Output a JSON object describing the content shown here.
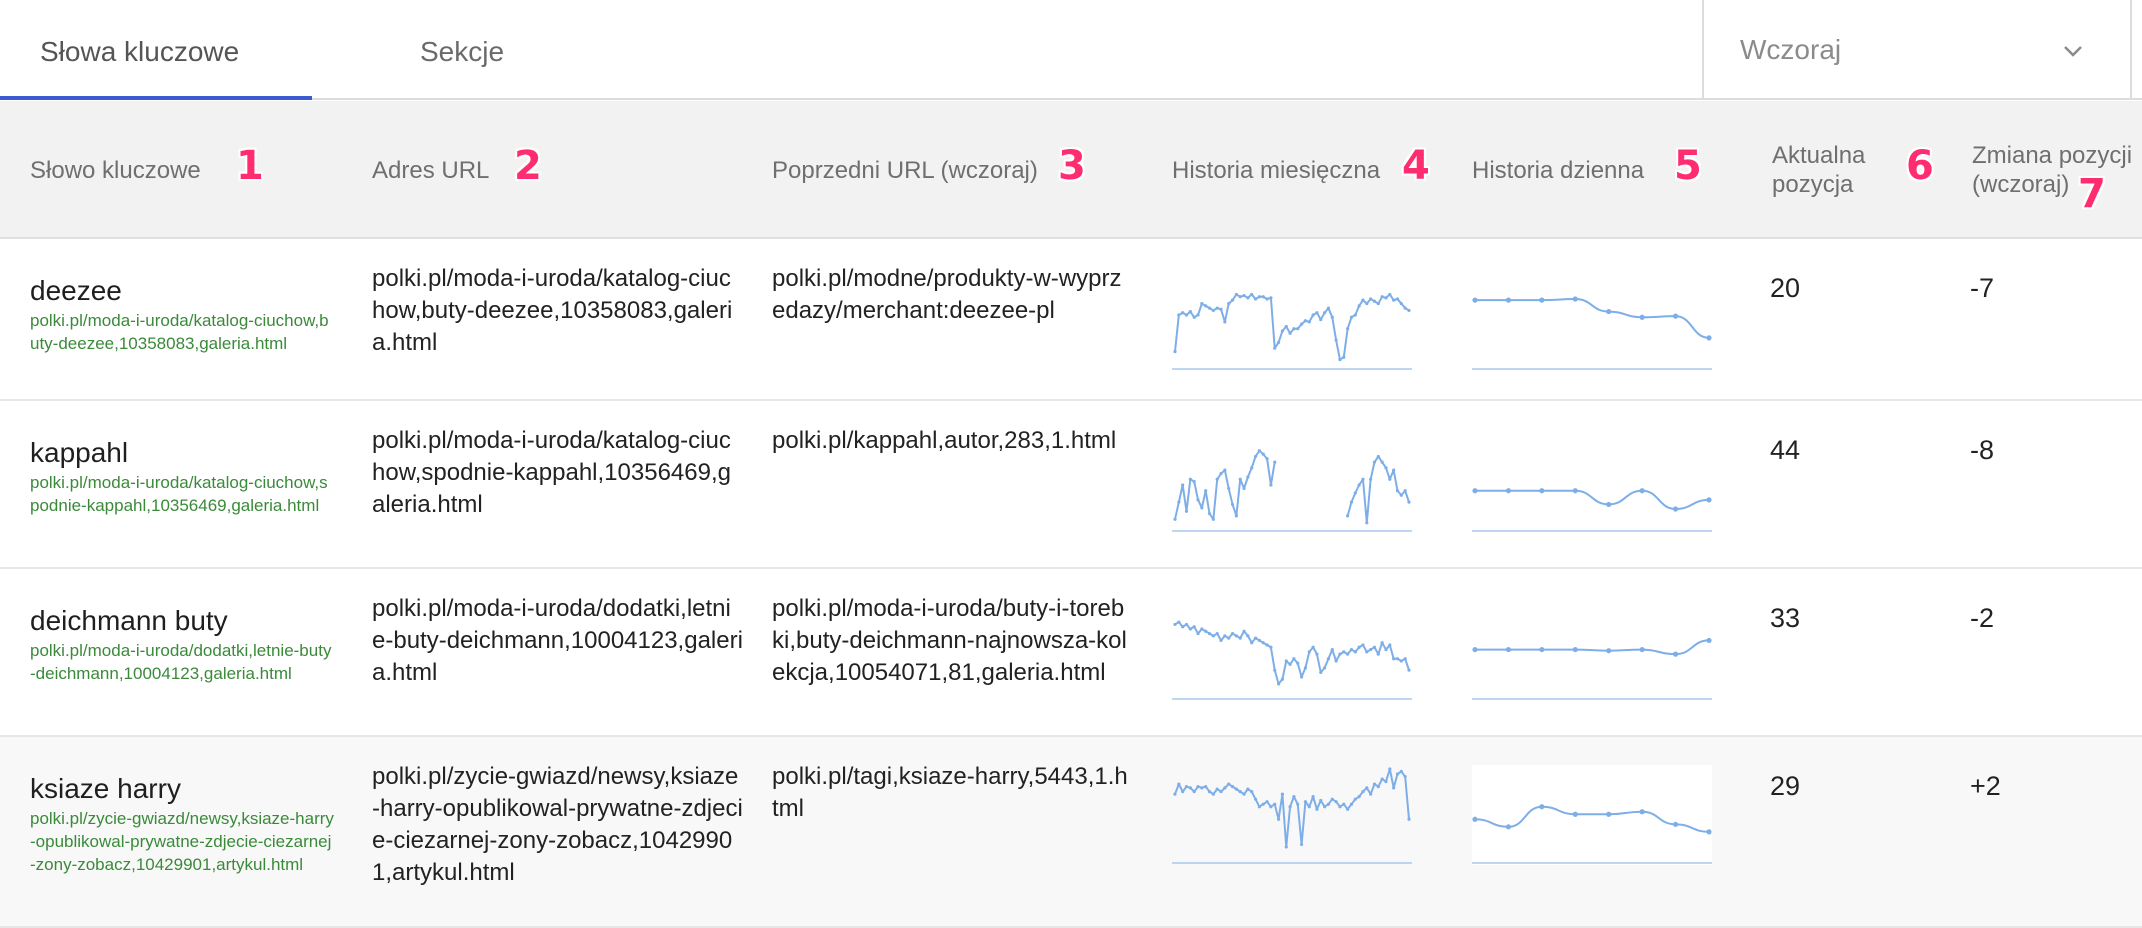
{
  "tabs": [
    {
      "label": "Słowa kluczowe",
      "active": true
    },
    {
      "label": "Sekcje",
      "active": false
    }
  ],
  "period": {
    "selected": "Wczoraj"
  },
  "columns": [
    {
      "label": "Słowo kluczowe",
      "marker": "1"
    },
    {
      "label": "Adres URL",
      "marker": "2"
    },
    {
      "label": "Poprzedni URL (wczoraj)",
      "marker": "3"
    },
    {
      "label": "Historia miesięczna",
      "marker": "4"
    },
    {
      "label": "Historia dzienna",
      "marker": "5"
    },
    {
      "label": "Aktualna pozycja",
      "marker": "6"
    },
    {
      "label": "Zmiana pozycji (wczoraj)",
      "marker": "7"
    }
  ],
  "colors": {
    "accent": "#3b5bd1",
    "marker": "#ff2d6f",
    "kw_url": "#3a8a3a",
    "spark": "#7eaee8"
  },
  "rows": [
    {
      "keyword": "deezee",
      "keyword_url": "polki.pl/moda-i-uroda/katalog-ciuchow,buty-deezee,10358083,galeria.html",
      "url": "polki.pl/moda-i-uroda/katalog-ciuchow,buty-deezee,10358083,galeria.html",
      "prev_url": "polki.pl/modne/produkty-w-wyprzedazy/merchant:deezee-pl",
      "position": "20",
      "change": "-7",
      "monthly": [
        10,
        42,
        44,
        42,
        45,
        40,
        42,
        52,
        50,
        48,
        46,
        48,
        47,
        36,
        52,
        55,
        60,
        58,
        59,
        57,
        60,
        56,
        58,
        58,
        56,
        57,
        13,
        18,
        28,
        32,
        26,
        30,
        30,
        34,
        37,
        36,
        42,
        44,
        38,
        44,
        48,
        40,
        20,
        3,
        5,
        30,
        40,
        42,
        50,
        55,
        52,
        56,
        54,
        52,
        58,
        57,
        60,
        55,
        56,
        52,
        48,
        46
      ],
      "daily": [
        55,
        55,
        55,
        56,
        45,
        40,
        41,
        22
      ],
      "daily_bg": false
    },
    {
      "keyword": "kappahl",
      "keyword_url": "polki.pl/moda-i-uroda/katalog-ciuchow,spodnie-kappahl,10356469,galeria.html",
      "url": "polki.pl/moda-i-uroda/katalog-ciuchow,spodnie-kappahl,10356469,galeria.html",
      "prev_url": "polki.pl/kappahl,autor,283,1.html",
      "position": "44",
      "change": "-8",
      "monthly": [
        5,
        20,
        35,
        12,
        40,
        38,
        22,
        15,
        30,
        10,
        5,
        40,
        45,
        48,
        32,
        18,
        8,
        40,
        32,
        42,
        50,
        60,
        65,
        62,
        58,
        35,
        55,
        null,
        null,
        null,
        null,
        null,
        null,
        null,
        null,
        null,
        null,
        null,
        null,
        null,
        null,
        null,
        null,
        null,
        null,
        8,
        20,
        28,
        35,
        40,
        2,
        40,
        55,
        60,
        55,
        50,
        40,
        48,
        30,
        26,
        30,
        20
      ],
      "daily": [
        30,
        30,
        30,
        30,
        18,
        30,
        14,
        22
      ],
      "daily_bg": false
    },
    {
      "keyword": "deichmann buty",
      "keyword_url": "polki.pl/moda-i-uroda/dodatki,letnie-buty-deichmann,10004123,galeria.html",
      "url": "polki.pl/moda-i-uroda/dodatki,letnie-buty-deichmann,10004123,galeria.html",
      "prev_url": "polki.pl/moda-i-uroda/buty-i-torebki,buty-deichmann-najnowsza-kolekcja,10054071,81,galeria.html",
      "position": "33",
      "change": "-2",
      "monthly": [
        60,
        62,
        58,
        60,
        56,
        58,
        52,
        56,
        54,
        52,
        50,
        52,
        46,
        50,
        48,
        52,
        50,
        48,
        54,
        50,
        44,
        48,
        46,
        44,
        42,
        40,
        20,
        8,
        12,
        28,
        25,
        30,
        26,
        14,
        22,
        36,
        40,
        34,
        18,
        22,
        30,
        38,
        28,
        34,
        36,
        34,
        38,
        36,
        40,
        42,
        36,
        38,
        40,
        34,
        44,
        38,
        42,
        30,
        30,
        28,
        30,
        20
      ],
      "daily": [
        38,
        38,
        38,
        38,
        37,
        38,
        34,
        46
      ],
      "daily_bg": false
    },
    {
      "keyword": "ksiaze harry",
      "keyword_url": "polki.pl/zycie-gwiazd/newsy,ksiaze-harry-opublikowal-prywatne-zdjecie-ciezarnej-zony-zobacz,10429901,artykul.html",
      "url": "polki.pl/zycie-gwiazd/newsy,ksiaze-harry-opublikowal-prywatne-zdjecie-ciezarnej-zony-zobacz,10429901,artykul.html",
      "prev_url": "polki.pl/tagi,ksiaze-harry,5443,1.html",
      "position": "29",
      "change": "+2",
      "monthly": [
        50,
        58,
        52,
        56,
        55,
        52,
        56,
        55,
        56,
        52,
        50,
        54,
        52,
        55,
        58,
        56,
        54,
        52,
        50,
        54,
        52,
        46,
        40,
        42,
        44,
        40,
        42,
        30,
        50,
        8,
        40,
        48,
        42,
        10,
        44,
        40,
        48,
        38,
        45,
        40,
        42,
        46,
        44,
        40,
        42,
        38,
        42,
        46,
        48,
        52,
        55,
        50,
        58,
        56,
        62,
        60,
        70,
        55,
        66,
        68,
        64,
        30
      ],
      "daily": [
        30,
        24,
        40,
        34,
        34,
        36,
        26,
        20
      ],
      "daily_bg": true
    }
  ]
}
